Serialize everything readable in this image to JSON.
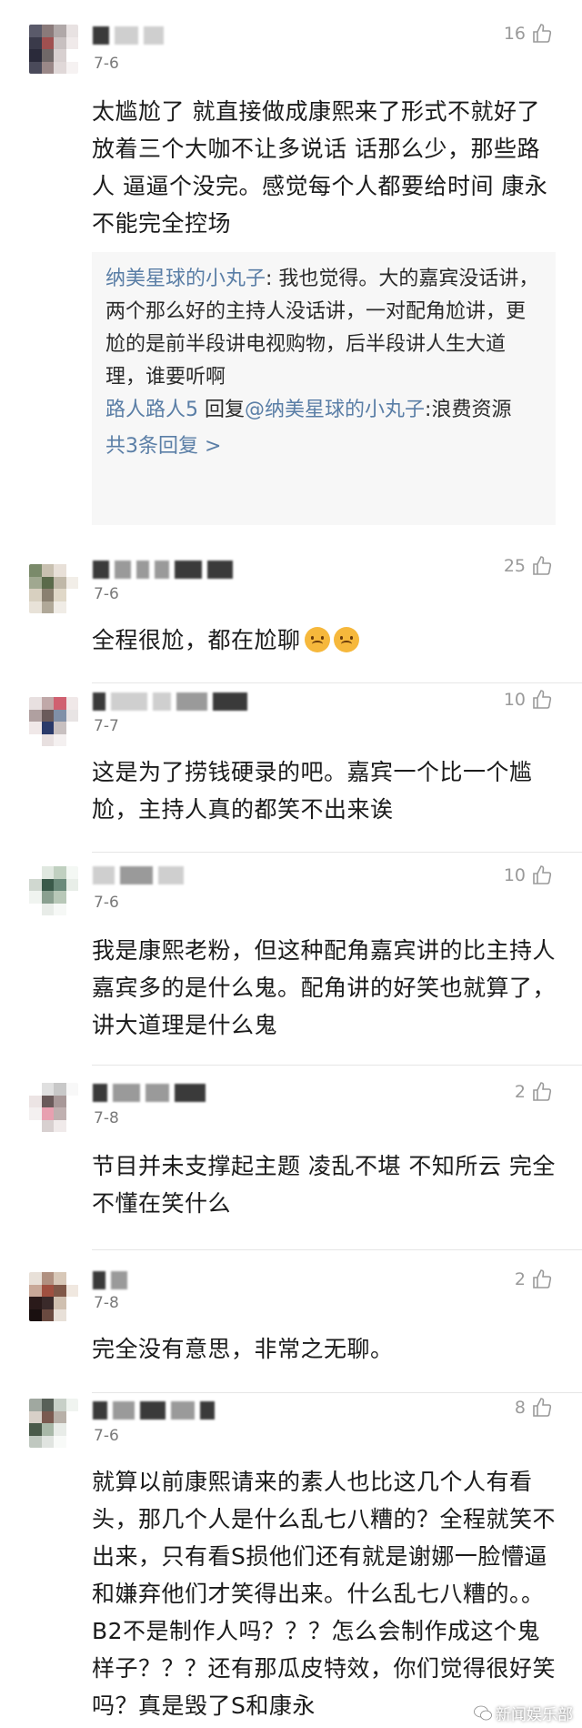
{
  "comments": [
    {
      "date": "7-6",
      "likes": "16",
      "text": "太尴尬了 就直接做成康熙来了形式不就好了  放着三个大咖不让多说话 话那么少，那些路人 逼逼个没完。感觉每个人都要给时间 康永不能完全控场",
      "replies": [
        {
          "author": "纳美星球的小丸子",
          "content": "我也觉得。大的嘉宾没话讲，两个那么好的主持人没话讲，一对配角尬讲，更尬的是前半段讲电视购物，后半段讲人生大道理，谁要听啊"
        },
        {
          "author": "路人路人5",
          "reply_word": "回复",
          "target": "@纳美星球的小丸子",
          "content": "浪费资源"
        }
      ],
      "more": "共3条回复 >"
    },
    {
      "date": "7-6",
      "likes": "25",
      "text": "全程很尬，都在尬聊"
    },
    {
      "date": "7-7",
      "likes": "10",
      "text": "这是为了捞钱硬录的吧。嘉宾一个比一个尴尬，主持人真的都笑不出来诶"
    },
    {
      "date": "7-6",
      "likes": "10",
      "text": "我是康熙老粉，但这种配角嘉宾讲的比主持人嘉宾多的是什么鬼。配角讲的好笑也就算了，讲大道理是什么鬼"
    },
    {
      "date": "7-8",
      "likes": "2",
      "text": "节目并未支撑起主题 凌乱不堪 不知所云 完全不懂在笑什么"
    },
    {
      "date": "7-8",
      "likes": "2",
      "text": "完全没有意思，非常之无聊。"
    },
    {
      "date": "7-6",
      "likes": "8",
      "text": "就算以前康熙请来的素人也比这几个人有看头，那几个人是什么乱七八糟的？全程就笑不出来，只有看S损他们还有就是谢娜一脸懵逼和嫌弃他们才笑得出来。什么乱七八糟的。。B2不是制作人吗？？？怎么会制作成这个鬼样子？？？还有那瓜皮特效，你们觉得很好笑吗？真是毁了S和康永"
    }
  ],
  "watermark": "新闻娱乐部",
  "icons": {
    "like": "thumbs-up-icon",
    "emoji": "upside-down-face-emoji",
    "watermark": "wechat-logo-icon"
  }
}
